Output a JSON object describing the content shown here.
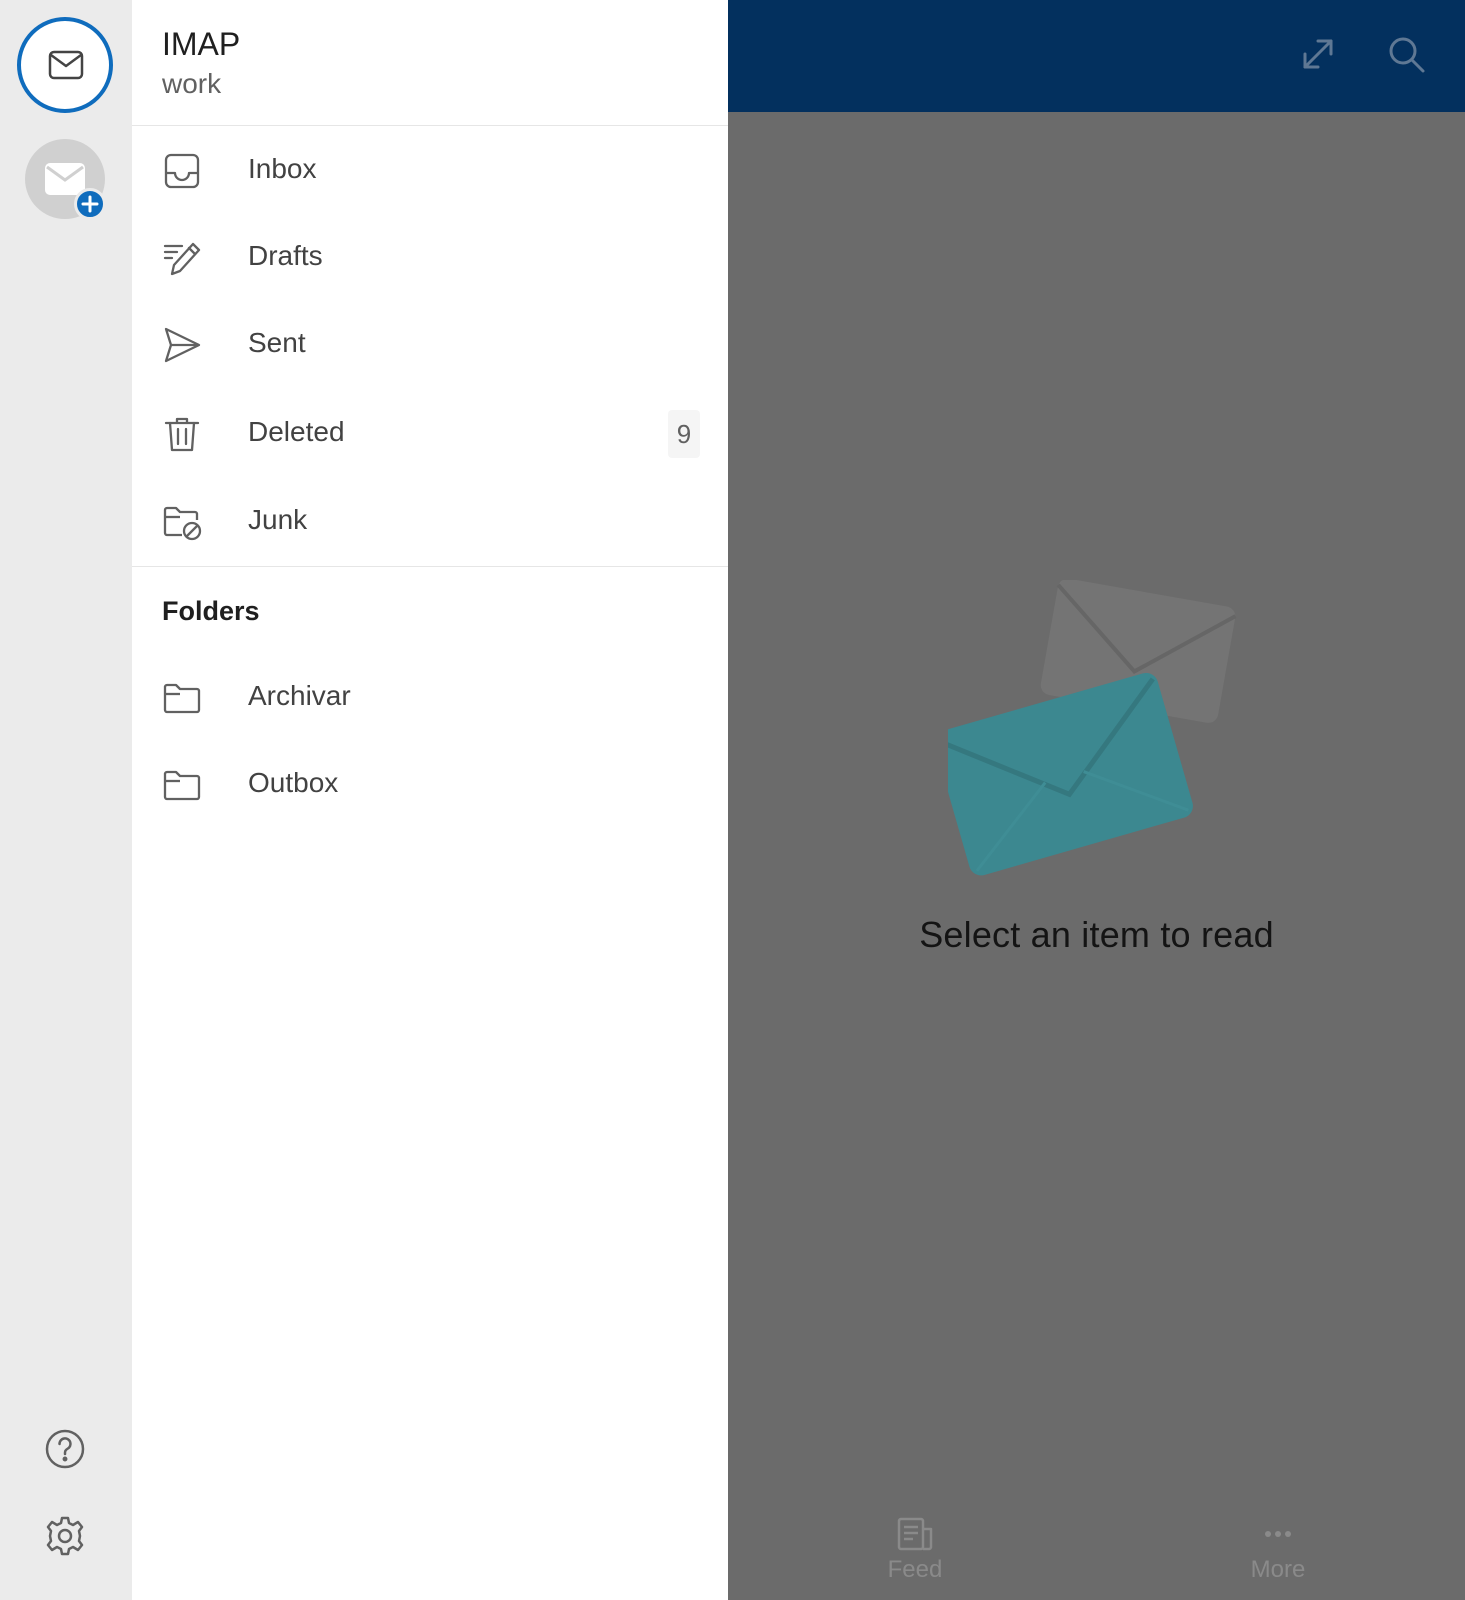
{
  "account": {
    "type": "IMAP",
    "name": "work"
  },
  "favorites": [
    {
      "label": "Inbox",
      "icon": "inbox-icon"
    },
    {
      "label": "Drafts",
      "icon": "drafts-pencil-icon"
    },
    {
      "label": "Sent",
      "icon": "sent-paper-plane-icon"
    },
    {
      "label": "Deleted",
      "icon": "trash-icon",
      "count": "9"
    },
    {
      "label": "Junk",
      "icon": "junk-folder-icon"
    }
  ],
  "folders_section": {
    "title": "Folders",
    "items": [
      {
        "label": "Archivar",
        "icon": "folder-icon"
      },
      {
        "label": "Outbox",
        "icon": "folder-icon"
      }
    ]
  },
  "reading_pane": {
    "empty_message": "Select an item to read"
  },
  "bottom_tabs": [
    {
      "label": "Feed",
      "icon": "feed-icon"
    },
    {
      "label": "More",
      "icon": "more-dots-icon"
    }
  ],
  "colors": {
    "accent": "#0f6cbd",
    "topbar": "#03305e",
    "scrim_gray": "#6b6b6b",
    "rail_background": "#ebebeb"
  }
}
